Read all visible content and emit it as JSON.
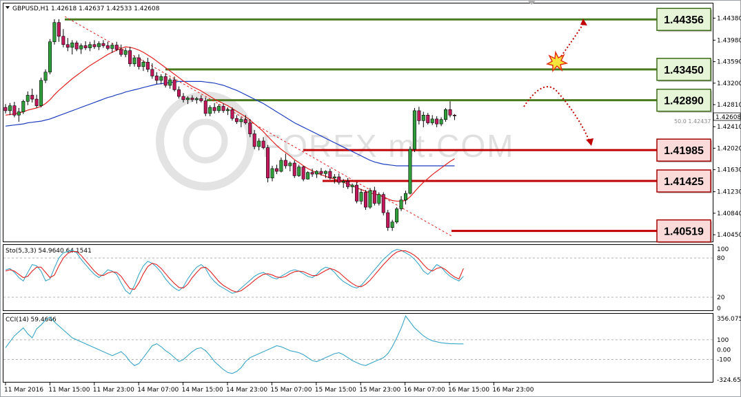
{
  "chart_data": {
    "type": "candlestick",
    "symbol_header": "GBPUSD,H1  1.42618 1.42637 1.42533 1.42608",
    "current_price": "1.42608",
    "price_axis": {
      "ticks": [
        "1.44380",
        "1.43980",
        "1.43590",
        "1.43200",
        "1.42810",
        "1.42410",
        "1.42020",
        "1.41630",
        "1.41230",
        "1.40840",
        "1.40450"
      ],
      "range": [
        1.40327,
        1.44646
      ]
    },
    "time_axis": [
      "11 Mar 2016",
      "11 Mar 15:00",
      "11 Mar 23:00",
      "14 Mar 07:00",
      "14 Mar 15:00",
      "14 Mar 23:00",
      "15 Mar 07:00",
      "15 Mar 15:00",
      "15 Mar 23:00",
      "16 Mar 07:00",
      "16 Mar 15:00",
      "16 Mar 23:00"
    ],
    "levels": [
      {
        "label": "1.44356",
        "value": 1.44356,
        "kind": "resistance",
        "color": "#4a7a1e"
      },
      {
        "label": "1.43450",
        "value": 1.4345,
        "kind": "resistance",
        "color": "#4a7a1e"
      },
      {
        "label": "1.42890",
        "value": 1.4289,
        "kind": "resistance",
        "color": "#4a7a1e"
      },
      {
        "label": "1.41985",
        "value": 1.41985,
        "kind": "support",
        "color": "#c00000"
      },
      {
        "label": "1.41425",
        "value": 1.41425,
        "kind": "support",
        "color": "#c00000"
      },
      {
        "label": "1.40519",
        "value": 1.40519,
        "kind": "support",
        "color": "#c00000"
      }
    ],
    "fib_label": "50.0 1.42437",
    "watermark": "FOREX mt.COM",
    "candles": [
      [
        1.4276,
        1.4282,
        1.4265,
        1.427
      ],
      [
        1.427,
        1.4284,
        1.4262,
        1.4279
      ],
      [
        1.4279,
        1.4286,
        1.4258,
        1.4262
      ],
      [
        1.4262,
        1.4275,
        1.425,
        1.4268
      ],
      [
        1.4268,
        1.429,
        1.4264,
        1.4287
      ],
      [
        1.4287,
        1.4305,
        1.428,
        1.4298
      ],
      [
        1.4298,
        1.431,
        1.4285,
        1.4291
      ],
      [
        1.4291,
        1.4299,
        1.4275,
        1.4279
      ],
      [
        1.4279,
        1.433,
        1.4276,
        1.4325
      ],
      [
        1.4325,
        1.4345,
        1.432,
        1.434
      ],
      [
        1.434,
        1.44,
        1.4336,
        1.4395
      ],
      [
        1.4395,
        1.4436,
        1.439,
        1.443
      ],
      [
        1.443,
        1.4436,
        1.4395,
        1.4405
      ],
      [
        1.4405,
        1.4418,
        1.4385,
        1.439
      ],
      [
        1.439,
        1.4402,
        1.4378,
        1.4385
      ],
      [
        1.4385,
        1.4398,
        1.4372,
        1.4393
      ],
      [
        1.4393,
        1.4397,
        1.4378,
        1.4382
      ],
      [
        1.4382,
        1.4392,
        1.4373,
        1.4388
      ],
      [
        1.4388,
        1.4396,
        1.438,
        1.4384
      ],
      [
        1.4384,
        1.4395,
        1.4378,
        1.439
      ],
      [
        1.439,
        1.4398,
        1.4382,
        1.4386
      ],
      [
        1.4386,
        1.4396,
        1.438,
        1.4392
      ],
      [
        1.4392,
        1.4398,
        1.4384,
        1.4388
      ],
      [
        1.4388,
        1.4395,
        1.438,
        1.4383
      ],
      [
        1.4383,
        1.4393,
        1.4375,
        1.4389
      ],
      [
        1.4389,
        1.4395,
        1.4378,
        1.4381
      ],
      [
        1.4381,
        1.439,
        1.4368,
        1.4372
      ],
      [
        1.4372,
        1.4384,
        1.4367,
        1.4379
      ],
      [
        1.4379,
        1.4386,
        1.435,
        1.4355
      ],
      [
        1.4355,
        1.437,
        1.435,
        1.4366
      ],
      [
        1.4366,
        1.4372,
        1.4345,
        1.435
      ],
      [
        1.435,
        1.4362,
        1.4342,
        1.4358
      ],
      [
        1.4358,
        1.4366,
        1.434,
        1.4345
      ],
      [
        1.4345,
        1.4356,
        1.4328,
        1.4333
      ],
      [
        1.4333,
        1.434,
        1.4318,
        1.4325
      ],
      [
        1.4325,
        1.4336,
        1.4318,
        1.4332
      ],
      [
        1.4332,
        1.4338,
        1.4312,
        1.4316
      ],
      [
        1.4316,
        1.433,
        1.431,
        1.4326
      ],
      [
        1.4326,
        1.4332,
        1.4305,
        1.4308
      ],
      [
        1.4308,
        1.4314,
        1.4292,
        1.4296
      ],
      [
        1.4296,
        1.4302,
        1.4285,
        1.429
      ],
      [
        1.429,
        1.4296,
        1.4282,
        1.4293
      ],
      [
        1.4293,
        1.4298,
        1.4286,
        1.429
      ],
      [
        1.429,
        1.4295,
        1.4283,
        1.4292
      ],
      [
        1.4292,
        1.4298,
        1.4285,
        1.4288
      ],
      [
        1.4288,
        1.4294,
        1.426,
        1.4265
      ],
      [
        1.4265,
        1.428,
        1.426,
        1.4276
      ],
      [
        1.4276,
        1.4284,
        1.4265,
        1.427
      ],
      [
        1.427,
        1.4282,
        1.4266,
        1.4278
      ],
      [
        1.4278,
        1.4283,
        1.4266,
        1.427
      ],
      [
        1.427,
        1.4276,
        1.4262,
        1.4272
      ],
      [
        1.4272,
        1.4276,
        1.4252,
        1.4256
      ],
      [
        1.4256,
        1.4262,
        1.4246,
        1.425
      ],
      [
        1.425,
        1.4258,
        1.424,
        1.4254
      ],
      [
        1.4254,
        1.4262,
        1.4245,
        1.4248
      ],
      [
        1.4248,
        1.4255,
        1.4222,
        1.4228
      ],
      [
        1.4228,
        1.4235,
        1.42,
        1.4205
      ],
      [
        1.4205,
        1.422,
        1.4198,
        1.4215
      ],
      [
        1.4215,
        1.4222,
        1.42,
        1.4203
      ],
      [
        1.4203,
        1.4208,
        1.414,
        1.4148
      ],
      [
        1.4148,
        1.417,
        1.4142,
        1.4165
      ],
      [
        1.4165,
        1.4172,
        1.4155,
        1.416
      ],
      [
        1.416,
        1.4185,
        1.4158,
        1.418
      ],
      [
        1.418,
        1.4192,
        1.4165,
        1.417
      ],
      [
        1.417,
        1.4178,
        1.416,
        1.4175
      ],
      [
        1.4175,
        1.418,
        1.4148,
        1.4152
      ],
      [
        1.4152,
        1.4172,
        1.415,
        1.4168
      ],
      [
        1.4168,
        1.417,
        1.4142,
        1.4146
      ],
      [
        1.4146,
        1.416,
        1.4145,
        1.4158
      ],
      [
        1.4158,
        1.4165,
        1.415,
        1.4155
      ],
      [
        1.4155,
        1.4162,
        1.4148,
        1.416
      ],
      [
        1.416,
        1.4166,
        1.4152,
        1.4156
      ],
      [
        1.4156,
        1.4162,
        1.4148,
        1.416
      ],
      [
        1.416,
        1.4165,
        1.4145,
        1.4148
      ],
      [
        1.4148,
        1.4155,
        1.4138,
        1.415
      ],
      [
        1.415,
        1.4156,
        1.4136,
        1.414
      ],
      [
        1.414,
        1.4146,
        1.413,
        1.4142
      ],
      [
        1.4142,
        1.4148,
        1.4128,
        1.4132
      ],
      [
        1.4132,
        1.4138,
        1.412,
        1.4135
      ],
      [
        1.4135,
        1.414,
        1.4102,
        1.4106
      ],
      [
        1.4106,
        1.4128,
        1.41,
        1.4122
      ],
      [
        1.4122,
        1.4126,
        1.409,
        1.4095
      ],
      [
        1.4095,
        1.413,
        1.4092,
        1.4125
      ],
      [
        1.4125,
        1.4132,
        1.4098,
        1.4102
      ],
      [
        1.4102,
        1.4122,
        1.4098,
        1.4118
      ],
      [
        1.4118,
        1.4122,
        1.408,
        1.4085
      ],
      [
        1.4085,
        1.409,
        1.4052,
        1.4058
      ],
      [
        1.4058,
        1.4072,
        1.4052,
        1.4068
      ],
      [
        1.4068,
        1.4095,
        1.4065,
        1.4092
      ],
      [
        1.4092,
        1.4115,
        1.4088,
        1.4108
      ],
      [
        1.4108,
        1.4125,
        1.41,
        1.412
      ],
      [
        1.412,
        1.4205,
        1.4118,
        1.42
      ],
      [
        1.42,
        1.4275,
        1.4195,
        1.427
      ],
      [
        1.427,
        1.4277,
        1.4245,
        1.4252
      ],
      [
        1.4252,
        1.4268,
        1.424,
        1.4262
      ],
      [
        1.4262,
        1.4266,
        1.4245,
        1.4248
      ],
      [
        1.4248,
        1.4262,
        1.4244,
        1.4255
      ],
      [
        1.4255,
        1.426,
        1.424,
        1.4246
      ],
      [
        1.4246,
        1.4258,
        1.4242,
        1.4254
      ],
      [
        1.4254,
        1.4275,
        1.425,
        1.4272
      ],
      [
        1.4272,
        1.4287,
        1.4258,
        1.4262
      ],
      [
        1.4262,
        1.4264,
        1.4253,
        1.4261
      ]
    ],
    "ma_red": [
      1.4262,
      1.4263,
      1.4264,
      1.4266,
      1.4268,
      1.4271,
      1.4273,
      1.4275,
      1.4278,
      1.4283,
      1.429,
      1.4299,
      1.4307,
      1.4314,
      1.4321,
      1.4328,
      1.4334,
      1.434,
      1.4346,
      1.4352,
      1.4357,
      1.4362,
      1.4367,
      1.4372,
      1.4376,
      1.438,
      1.4383,
      1.4386,
      1.4385,
      1.4383,
      1.438,
      1.4376,
      1.4371,
      1.4366,
      1.436,
      1.4354,
      1.4348,
      1.4342,
      1.4336,
      1.433,
      1.4324,
      1.4319,
      1.4314,
      1.431,
      1.4306,
      1.4301,
      1.4296,
      1.4291,
      1.4287,
      1.4283,
      1.4279,
      1.4274,
      1.4269,
      1.4264,
      1.4259,
      1.4253,
      1.4246,
      1.4239,
      1.4232,
      1.4223,
      1.4215,
      1.4207,
      1.42,
      1.4194,
      1.4188,
      1.4181,
      1.4176,
      1.417,
      1.4165,
      1.4161,
      1.4157,
      1.4154,
      1.4151,
      1.4148,
      1.4146,
      1.4143,
      1.414,
      1.4137,
      1.4134,
      1.413,
      1.4127,
      1.4124,
      1.4121,
      1.4119,
      1.4117,
      1.4114,
      1.411,
      1.4107,
      1.4106,
      1.4106,
      1.4107,
      1.4114,
      1.4123,
      1.4132,
      1.414,
      1.4147,
      1.4154,
      1.416,
      1.4166,
      1.4172,
      1.4178,
      1.4183
    ],
    "ma_blue": [
      1.4242,
      1.4243,
      1.4244,
      1.4245,
      1.4246,
      1.4248,
      1.4249,
      1.425,
      1.4251,
      1.4253,
      1.4255,
      1.4258,
      1.4261,
      1.4264,
      1.4267,
      1.427,
      1.4273,
      1.4276,
      1.4279,
      1.4282,
      1.4285,
      1.4288,
      1.4291,
      1.4294,
      1.4296,
      1.4299,
      1.4301,
      1.4304,
      1.4306,
      1.4308,
      1.431,
      1.4312,
      1.4314,
      1.4316,
      1.4318,
      1.4319,
      1.432,
      1.4321,
      1.4322,
      1.4323,
      1.4323,
      1.4323,
      1.4323,
      1.4323,
      1.4323,
      1.4322,
      1.4321,
      1.432,
      1.4318,
      1.4316,
      1.4313,
      1.431,
      1.4307,
      1.4303,
      1.4299,
      1.4295,
      1.4291,
      1.4287,
      1.4283,
      1.4278,
      1.4273,
      1.4268,
      1.4263,
      1.4258,
      1.4253,
      1.4248,
      1.4244,
      1.424,
      1.4236,
      1.4232,
      1.4228,
      1.4224,
      1.422,
      1.4216,
      1.4212,
      1.4208,
      1.4204,
      1.42,
      1.4196,
      1.4192,
      1.4188,
      1.4184,
      1.418,
      1.4177,
      1.4175,
      1.4173,
      1.4172,
      1.4171,
      1.417,
      1.417,
      1.417,
      1.417,
      1.417,
      1.417,
      1.417,
      1.417,
      1.417,
      1.417,
      1.417,
      1.417,
      1.417,
      1.417
    ],
    "stochastic": {
      "title": "Sto(5,3,3) 54.9640 64.1541",
      "levels": [
        "100",
        "80",
        "20",
        "0"
      ],
      "k": [
        62,
        64,
        58,
        50,
        45,
        58,
        70,
        68,
        60,
        45,
        48,
        65,
        80,
        88,
        90,
        92,
        88,
        78,
        70,
        62,
        55,
        50,
        55,
        62,
        60,
        55,
        42,
        30,
        25,
        38,
        55,
        68,
        75,
        72,
        66,
        58,
        48,
        40,
        34,
        30,
        36,
        48,
        58,
        66,
        70,
        64,
        52,
        44,
        38,
        34,
        30,
        26,
        28,
        34,
        40,
        46,
        52,
        56,
        58,
        54,
        50,
        48,
        52,
        56,
        60,
        62,
        60,
        56,
        52,
        50,
        55,
        62,
        66,
        64,
        58,
        50,
        44,
        40,
        36,
        34,
        38,
        46,
        54,
        62,
        70,
        78,
        84,
        90,
        93,
        92,
        88,
        84,
        78,
        70,
        60,
        55,
        62,
        70,
        66,
        58,
        52,
        48,
        45,
        52
      ],
      "d": [
        60,
        62,
        60,
        55,
        50,
        52,
        60,
        66,
        66,
        58,
        50,
        54,
        68,
        80,
        87,
        90,
        90,
        84,
        76,
        68,
        60,
        54,
        53,
        57,
        59,
        58,
        52,
        42,
        33,
        32,
        42,
        56,
        67,
        72,
        70,
        64,
        56,
        48,
        41,
        35,
        34,
        40,
        50,
        58,
        65,
        66,
        60,
        52,
        44,
        38,
        34,
        30,
        28,
        30,
        35,
        40,
        46,
        51,
        55,
        56,
        54,
        51,
        50,
        52,
        56,
        59,
        60,
        59,
        56,
        53,
        53,
        57,
        61,
        64,
        62,
        58,
        52,
        46,
        41,
        37,
        36,
        40,
        46,
        54,
        62,
        70,
        77,
        84,
        89,
        91,
        91,
        88,
        84,
        78,
        70,
        63,
        60,
        64,
        66,
        62,
        56,
        51,
        48,
        64
      ]
    },
    "cci": {
      "title": "CCI(14) 59.4646",
      "levels": [
        "356.075",
        "100",
        "0.00",
        "-100",
        "-324.652"
      ],
      "values": [
        20,
        80,
        140,
        180,
        220,
        160,
        120,
        210,
        250,
        300,
        330,
        280,
        240,
        200,
        160,
        120,
        100,
        80,
        60,
        40,
        20,
        0,
        -20,
        -40,
        -60,
        -40,
        -20,
        -60,
        -120,
        -160,
        -140,
        -80,
        -20,
        40,
        60,
        30,
        -10,
        -40,
        -80,
        -120,
        -100,
        -60,
        -20,
        10,
        20,
        -10,
        -60,
        -120,
        -160,
        -200,
        -230,
        -240,
        -220,
        -180,
        -120,
        -80,
        -60,
        -40,
        -20,
        0,
        20,
        40,
        30,
        10,
        -10,
        -20,
        -30,
        -50,
        -80,
        -110,
        -120,
        -100,
        -80,
        -60,
        -40,
        -30,
        -50,
        -80,
        -110,
        -130,
        -150,
        -160,
        -140,
        -120,
        -100,
        -80,
        -40,
        30,
        120,
        220,
        340,
        280,
        220,
        180,
        140,
        110,
        90,
        80,
        70,
        65,
        60,
        60,
        59,
        59
      ]
    },
    "levels_color_resistance": "#4a7a1e",
    "levels_color_support": "#c00000",
    "grid": true
  }
}
